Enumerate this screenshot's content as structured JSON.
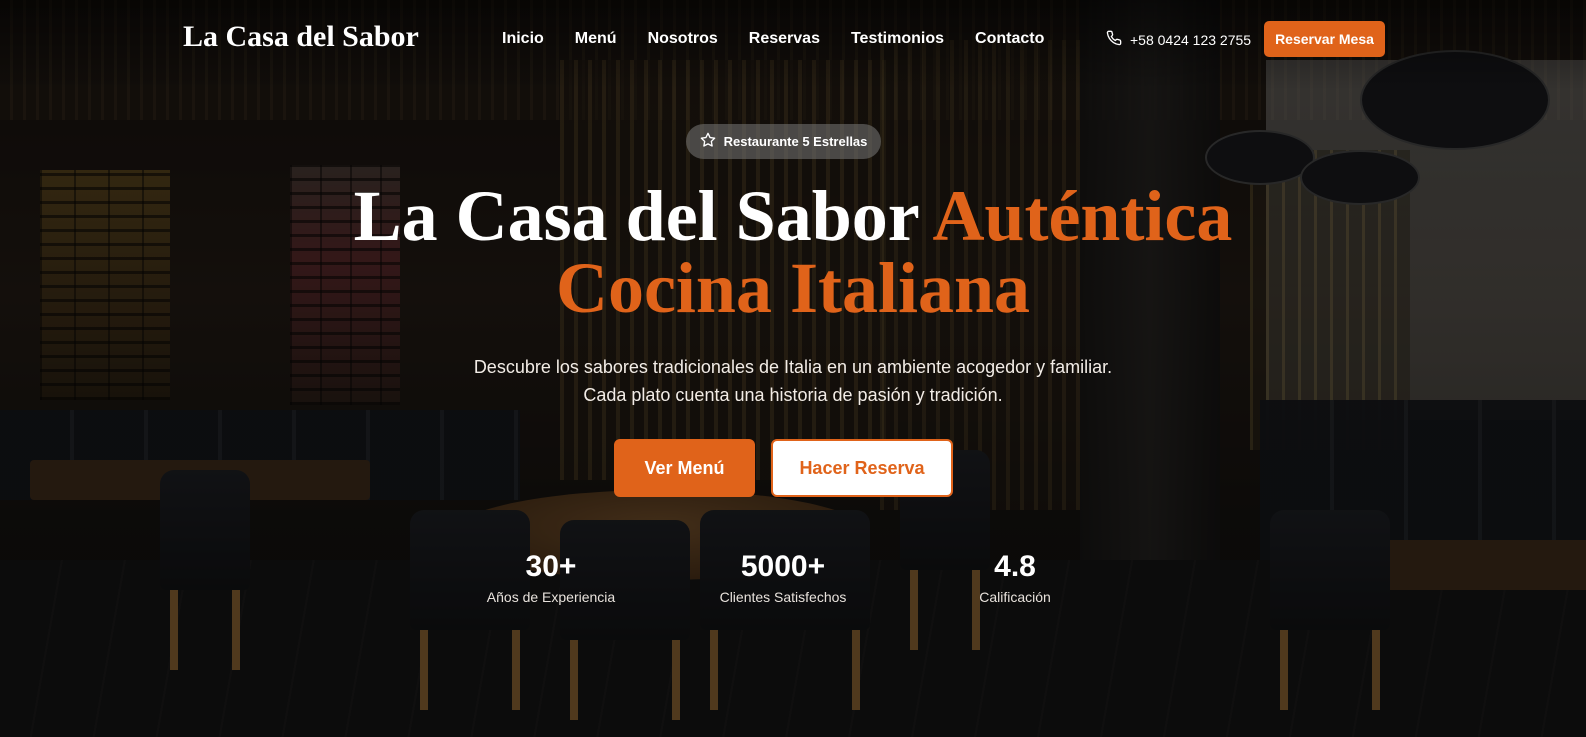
{
  "brand": {
    "name": "La Casa del Sabor",
    "accent_color": "#e0631a"
  },
  "nav": {
    "links": [
      "Inicio",
      "Menú",
      "Nosotros",
      "Reservas",
      "Testimonios",
      "Contacto"
    ],
    "phone": "+58 0424 123 2755",
    "phone_icon": "phone-icon",
    "cta": "Reservar Mesa"
  },
  "hero": {
    "badge": "Restaurante 5 Estrellas",
    "badge_icon": "star-icon",
    "title_part1": "La Casa del Sabor",
    "title_accent": "Auténtica",
    "title_line2": "Cocina Italiana",
    "lead_line1": "Descubre los sabores tradicionales de Italia en un ambiente acogedor y familiar.",
    "lead_line2": "Cada plato cuenta una historia de pasión y tradición.",
    "primary_button": "Ver Menú",
    "secondary_button": "Hacer Reserva"
  },
  "stats": [
    {
      "value": "30+",
      "label": "Años de Experiencia"
    },
    {
      "value": "5000+",
      "label": "Clientes Satisfechos"
    },
    {
      "value": "4.8",
      "label": "Calificación"
    }
  ]
}
